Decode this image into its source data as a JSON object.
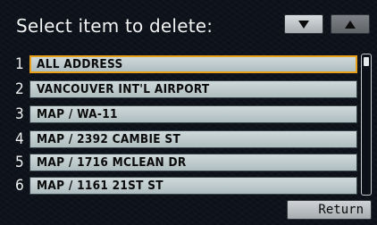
{
  "header": {
    "title": "Select item to delete:"
  },
  "scroll_buttons": {
    "down_icon": "down-triangle",
    "up_icon": "up-triangle"
  },
  "list": {
    "items": [
      {
        "number": "1",
        "label": "ALL ADDRESS",
        "selected": true
      },
      {
        "number": "2",
        "label": "VANCOUVER INT'L AIRPORT"
      },
      {
        "number": "3",
        "label": "MAP / WA-11"
      },
      {
        "number": "4",
        "label": "MAP / 2392 CAMBIE ST"
      },
      {
        "number": "5",
        "label": "MAP / 1716 MCLEAN DR"
      },
      {
        "number": "6",
        "label": "MAP / 1161 21ST ST"
      }
    ]
  },
  "footer": {
    "return_label": "Return"
  },
  "colors": {
    "selection_border": "#e8a11a",
    "item_background": "#cfd9db",
    "screen_background": "#0c1019"
  }
}
